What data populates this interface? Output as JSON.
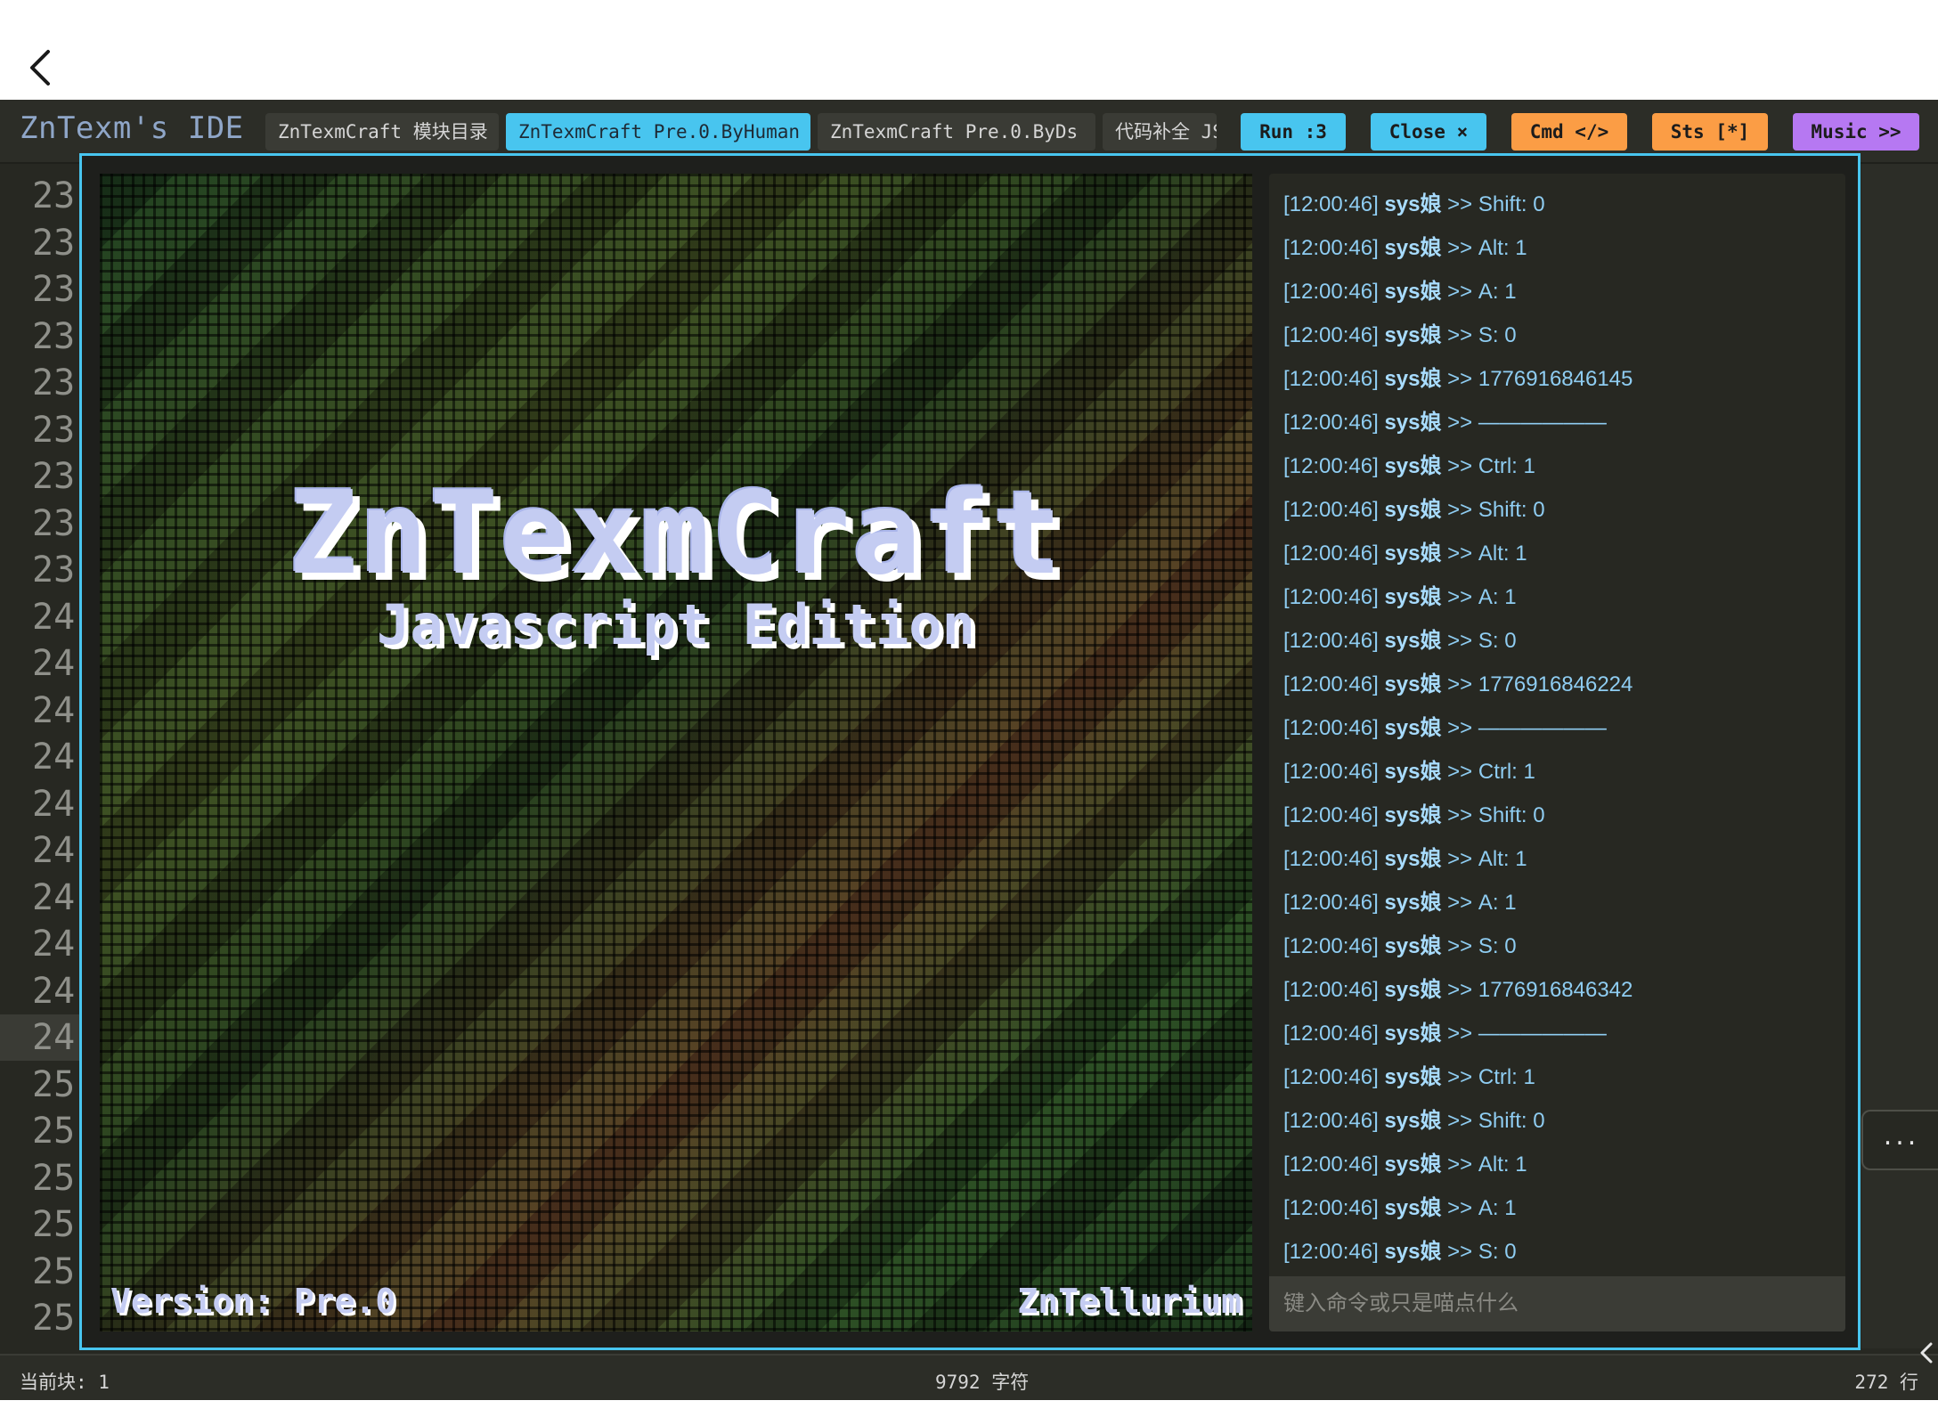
{
  "header": {
    "ide_title": "ZnTexm's IDE",
    "tabs": [
      {
        "label": "ZnTexmCraft 模块目录",
        "active": false
      },
      {
        "label": "ZnTexmCraft Pre.0.ByHuman",
        "active": true
      },
      {
        "label": "ZnTexmCraft Pre.0.ByDs",
        "active": false
      },
      {
        "label": "代码补全 JS",
        "active": false
      }
    ],
    "buttons": {
      "run": "Run :3",
      "close": "Close ×",
      "cmd": "Cmd </>",
      "sts": "Sts [*]",
      "music": "Music >>"
    }
  },
  "gutter": {
    "line_numbers": [
      "23",
      "23",
      "23",
      "23",
      "23",
      "23",
      "23",
      "23",
      "23",
      "24",
      "24",
      "24",
      "24",
      "24",
      "24",
      "24",
      "24",
      "24",
      "24",
      "25",
      "25",
      "25",
      "25",
      "25",
      "25"
    ]
  },
  "game": {
    "title": "ZnTexmCraft",
    "subtitle": "Javascript Edition",
    "version": "Version: Pre.0",
    "author": "ZnTellurium"
  },
  "console": {
    "lines": [
      {
        "time": "[12:00:46]",
        "who": "sys娘",
        "msg": ">> Shift: 0"
      },
      {
        "time": "[12:00:46]",
        "who": "sys娘",
        "msg": ">> Alt: 1"
      },
      {
        "time": "[12:00:46]",
        "who": "sys娘",
        "msg": ">> A: 1"
      },
      {
        "time": "[12:00:46]",
        "who": "sys娘",
        "msg": ">> S: 0"
      },
      {
        "time": "[12:00:46]",
        "who": "sys娘",
        "msg": ">> 1776916846145"
      },
      {
        "time": "[12:00:46]",
        "who": "sys娘",
        "msg": ">> ——————"
      },
      {
        "time": "[12:00:46]",
        "who": "sys娘",
        "msg": ">> Ctrl: 1"
      },
      {
        "time": "[12:00:46]",
        "who": "sys娘",
        "msg": ">> Shift: 0"
      },
      {
        "time": "[12:00:46]",
        "who": "sys娘",
        "msg": ">> Alt: 1"
      },
      {
        "time": "[12:00:46]",
        "who": "sys娘",
        "msg": ">> A: 1"
      },
      {
        "time": "[12:00:46]",
        "who": "sys娘",
        "msg": ">> S: 0"
      },
      {
        "time": "[12:00:46]",
        "who": "sys娘",
        "msg": ">> 1776916846224"
      },
      {
        "time": "[12:00:46]",
        "who": "sys娘",
        "msg": ">> ——————"
      },
      {
        "time": "[12:00:46]",
        "who": "sys娘",
        "msg": ">> Ctrl: 1"
      },
      {
        "time": "[12:00:46]",
        "who": "sys娘",
        "msg": ">> Shift: 0"
      },
      {
        "time": "[12:00:46]",
        "who": "sys娘",
        "msg": ">> Alt: 1"
      },
      {
        "time": "[12:00:46]",
        "who": "sys娘",
        "msg": ">> A: 1"
      },
      {
        "time": "[12:00:46]",
        "who": "sys娘",
        "msg": ">> S: 0"
      },
      {
        "time": "[12:00:46]",
        "who": "sys娘",
        "msg": ">> 1776916846342"
      },
      {
        "time": "[12:00:46]",
        "who": "sys娘",
        "msg": ">> ——————"
      },
      {
        "time": "[12:00:46]",
        "who": "sys娘",
        "msg": ">> Ctrl: 1"
      },
      {
        "time": "[12:00:46]",
        "who": "sys娘",
        "msg": ">> Shift: 0"
      },
      {
        "time": "[12:00:46]",
        "who": "sys娘",
        "msg": ">> Alt: 1"
      },
      {
        "time": "[12:00:46]",
        "who": "sys娘",
        "msg": ">> A: 1"
      },
      {
        "time": "[12:00:46]",
        "who": "sys娘",
        "msg": ">> S: 0"
      }
    ],
    "input_placeholder": "键入命令或只是喵点什么",
    "input_value": ""
  },
  "more_button": "...",
  "status": {
    "current_block": "当前块: 1",
    "chars": "9792 字符",
    "lines": "272 行"
  },
  "colors": {
    "accent_blue": "#48c5ef",
    "accent_orange": "#fb9d45",
    "accent_purple": "#b678f2",
    "editor_bg": "#272822"
  },
  "icons": {
    "back": "chevron-left-icon",
    "side": "chevron-left-icon"
  }
}
